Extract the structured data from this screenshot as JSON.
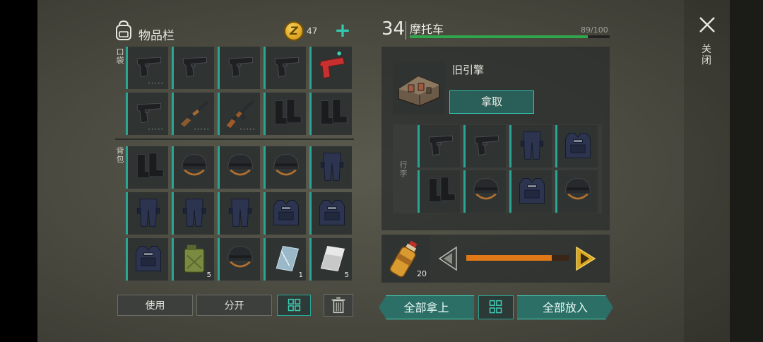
{
  "inventory": {
    "title": "物品栏",
    "coins": "47",
    "pocket_label": "口袋",
    "backpack_label": "背包",
    "pocket_items": [
      {
        "icon": "pistol-icon",
        "name": "pistol",
        "dura": "•••••"
      },
      {
        "icon": "pistol-icon",
        "name": "pistol",
        "dura": ""
      },
      {
        "icon": "pistol-icon",
        "name": "pistol",
        "dura": ""
      },
      {
        "icon": "pistol-icon",
        "name": "pistol",
        "dura": ""
      },
      {
        "icon": "flare-gun-icon",
        "name": "flare-gun",
        "dura": ""
      },
      {
        "icon": "pistol-icon",
        "name": "pistol",
        "dura": "•••••"
      },
      {
        "icon": "shotgun-icon",
        "name": "shotgun",
        "dura": "•••••"
      },
      {
        "icon": "rifle-icon",
        "name": "rifle",
        "dura": "•••••"
      },
      {
        "icon": "boots-icon",
        "name": "boots",
        "dura": ""
      },
      {
        "icon": "boots-icon",
        "name": "boots",
        "dura": ""
      }
    ],
    "backpack_items": [
      {
        "icon": "boots-icon",
        "name": "boots",
        "qty": ""
      },
      {
        "icon": "helmet-icon",
        "name": "helmet",
        "qty": ""
      },
      {
        "icon": "helmet-icon",
        "name": "helmet",
        "qty": ""
      },
      {
        "icon": "helmet-icon",
        "name": "helmet",
        "qty": ""
      },
      {
        "icon": "pants-icon",
        "name": "pants",
        "qty": ""
      },
      {
        "icon": "pants-icon",
        "name": "pants",
        "qty": ""
      },
      {
        "icon": "pants-icon",
        "name": "pants",
        "qty": ""
      },
      {
        "icon": "pants-icon",
        "name": "pants",
        "qty": ""
      },
      {
        "icon": "vest-icon",
        "name": "vest",
        "qty": ""
      },
      {
        "icon": "vest-icon",
        "name": "vest",
        "qty": ""
      },
      {
        "icon": "vest-icon",
        "name": "vest",
        "qty": ""
      },
      {
        "icon": "jerrycan-icon",
        "name": "jerrycan",
        "qty": "5"
      },
      {
        "icon": "helmet-icon",
        "name": "helmet",
        "qty": ""
      },
      {
        "icon": "glass-sheet-icon",
        "name": "glass-sheet",
        "qty": "1"
      },
      {
        "icon": "metal-sheet-icon",
        "name": "metal-sheet",
        "qty": "5"
      }
    ],
    "use_label": "使用",
    "split_label": "分开"
  },
  "vehicle": {
    "level": "34",
    "name": "摩托车",
    "hp_text": "89/100",
    "hp_fraction": 0.89,
    "engine_name": "旧引擎",
    "take_label": "拿取",
    "trunk_label": "行李",
    "trunk_items": [
      {
        "icon": "pistol-icon",
        "name": "pistol"
      },
      {
        "icon": "pistol-icon",
        "name": "pistol"
      },
      {
        "icon": "pants-icon",
        "name": "pants"
      },
      {
        "icon": "vest-icon",
        "name": "vest"
      },
      {
        "icon": "boots-icon",
        "name": "boots"
      },
      {
        "icon": "helmet-icon",
        "name": "helmet"
      },
      {
        "icon": "vest-icon",
        "name": "vest"
      },
      {
        "icon": "helmet-icon",
        "name": "helmet"
      }
    ],
    "fuel_qty": "20",
    "fuel_fraction": 0.83,
    "take_all_label": "全部拿上",
    "put_all_label": "全部放入"
  },
  "close_label": "关闭",
  "colors": {
    "accent": "#2aa594",
    "hp": "#31a54c",
    "fuel": "#e07818",
    "coin": "#f0c040"
  }
}
